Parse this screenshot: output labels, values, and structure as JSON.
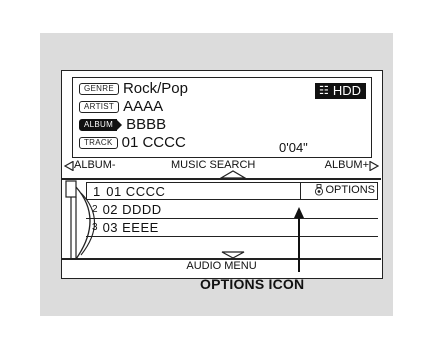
{
  "info": {
    "genre_tag": "GENRE",
    "genre": "Rock/Pop",
    "artist_tag": "ARTIST",
    "artist": "AAAA",
    "album_tag": "ALBUM",
    "album": "BBBB",
    "track_tag": "TRACK",
    "track": "01 CCCC",
    "time": "0'04\"",
    "source": "HDD",
    "source_icon": "hdd-icon"
  },
  "nav": {
    "left": "ALBUM-",
    "title": "MUSIC SEARCH",
    "right": "ALBUM+"
  },
  "list": [
    {
      "num": "1",
      "text": "01  CCCC"
    },
    {
      "num": "2",
      "text": "02  DDDD"
    },
    {
      "num": "3",
      "text": "03  EEEE"
    }
  ],
  "options_label": "OPTIONS",
  "menu_label": "AUDIO MENU",
  "callout": "OPTIONS ICON"
}
